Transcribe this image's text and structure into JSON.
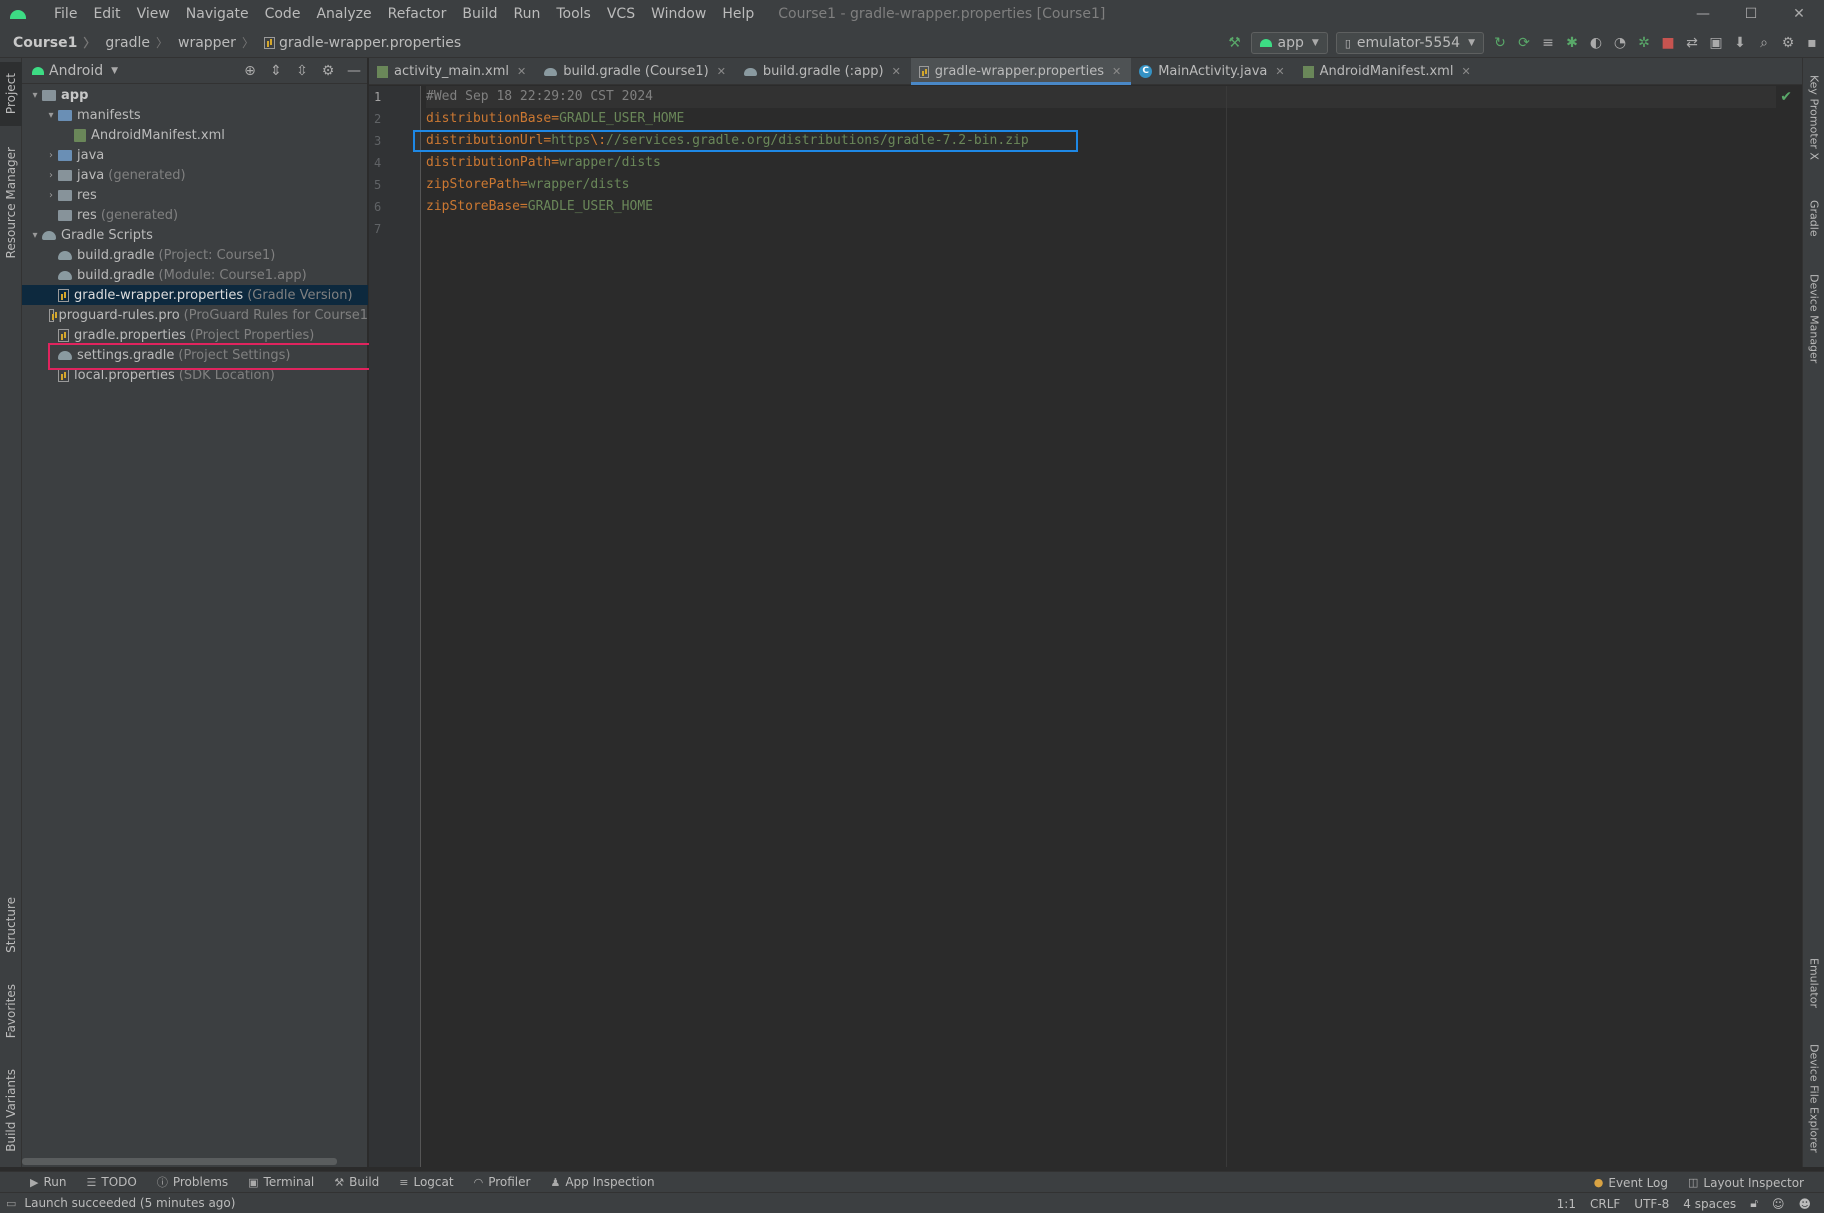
{
  "menu": [
    "File",
    "Edit",
    "View",
    "Navigate",
    "Code",
    "Analyze",
    "Refactor",
    "Build",
    "Run",
    "Tools",
    "VCS",
    "Window",
    "Help"
  ],
  "window_title": "Course1 - gradle-wrapper.properties [Course1]",
  "window_controls": {
    "minimize": "—",
    "maximize": "☐",
    "close": "✕"
  },
  "breadcrumb": [
    "Course1",
    "gradle",
    "wrapper",
    "gradle-wrapper.properties"
  ],
  "run_config": "app",
  "device": "emulator-5554",
  "project_view": "Android",
  "tree": [
    {
      "label": "app",
      "level": 0,
      "arrow": "▾",
      "icon": "folder",
      "bold": true
    },
    {
      "label": "manifests",
      "level": 1,
      "arrow": "▾",
      "icon": "folder-blue"
    },
    {
      "label": "AndroidManifest.xml",
      "level": 2,
      "arrow": "",
      "icon": "xml"
    },
    {
      "label": "java",
      "level": 1,
      "arrow": "›",
      "icon": "folder-blue"
    },
    {
      "label": "java",
      "hint": "(generated)",
      "level": 1,
      "arrow": "›",
      "icon": "folder"
    },
    {
      "label": "res",
      "level": 1,
      "arrow": "›",
      "icon": "folder"
    },
    {
      "label": "res",
      "hint": "(generated)",
      "level": 1,
      "arrow": "",
      "icon": "folder"
    },
    {
      "label": "Gradle Scripts",
      "level": 0,
      "arrow": "▾",
      "icon": "gradle"
    },
    {
      "label": "build.gradle",
      "hint": "(Project: Course1)",
      "level": 1,
      "arrow": "",
      "icon": "gradle"
    },
    {
      "label": "build.gradle",
      "hint": "(Module: Course1.app)",
      "level": 1,
      "arrow": "",
      "icon": "gradle"
    },
    {
      "label": "gradle-wrapper.properties",
      "hint": "(Gradle Version)",
      "level": 1,
      "arrow": "",
      "icon": "prop",
      "selected": true
    },
    {
      "label": "proguard-rules.pro",
      "hint": "(ProGuard Rules for Course1",
      "level": 1,
      "arrow": "",
      "icon": "prop"
    },
    {
      "label": "gradle.properties",
      "hint": "(Project Properties)",
      "level": 1,
      "arrow": "",
      "icon": "prop"
    },
    {
      "label": "settings.gradle",
      "hint": "(Project Settings)",
      "level": 1,
      "arrow": "",
      "icon": "gradle"
    },
    {
      "label": "local.properties",
      "hint": "(SDK Location)",
      "level": 1,
      "arrow": "",
      "icon": "prop"
    }
  ],
  "editor_tabs": [
    {
      "label": "activity_main.xml",
      "icon": "xml"
    },
    {
      "label": "build.gradle (Course1)",
      "icon": "gradle"
    },
    {
      "label": "build.gradle (:app)",
      "icon": "gradle"
    },
    {
      "label": "gradle-wrapper.properties",
      "icon": "prop",
      "active": true
    },
    {
      "label": "MainActivity.java",
      "icon": "java"
    },
    {
      "label": "AndroidManifest.xml",
      "icon": "xml",
      "closable": false
    }
  ],
  "code": [
    {
      "line": "1",
      "comment": "#Wed Sep 18 22:29:20 CST 2024"
    },
    {
      "line": "2",
      "key": "distributionBase",
      "value": "GRADLE_USER_HOME"
    },
    {
      "line": "3",
      "key": "distributionUrl",
      "value_pre": "https",
      "escape": "\\:",
      "value": "//services.gradle.org/distributions/gradle-7.2-bin.zip"
    },
    {
      "line": "4",
      "key": "distributionPath",
      "value": "wrapper/dists"
    },
    {
      "line": "5",
      "key": "zipStorePath",
      "value": "wrapper/dists"
    },
    {
      "line": "6",
      "key": "zipStoreBase",
      "value": "GRADLE_USER_HOME"
    },
    {
      "line": "7"
    }
  ],
  "left_stripe": [
    "Project",
    "Resource Manager",
    "Structure",
    "Favorites",
    "Build Variants"
  ],
  "right_stripe": [
    "Key Promoter X",
    "Gradle",
    "Device Manager",
    "Emulator",
    "Device File Explorer"
  ],
  "bottom_tools": [
    "Run",
    "TODO",
    "Problems",
    "Terminal",
    "Build",
    "Logcat",
    "Profiler",
    "App Inspection"
  ],
  "bottom_tools_right": [
    "Event Log",
    "Layout Inspector"
  ],
  "status": {
    "message": "Launch succeeded (5 minutes ago)",
    "position": "1:1",
    "line_sep": "CRLF",
    "encoding": "UTF-8",
    "indent": "4 spaces"
  },
  "colors": {
    "accent": "#4a88c7",
    "highlight_red": "#e0245e",
    "highlight_blue": "#1e88e5",
    "key": "#cc7832",
    "value": "#6a8759",
    "comment": "#808080"
  }
}
